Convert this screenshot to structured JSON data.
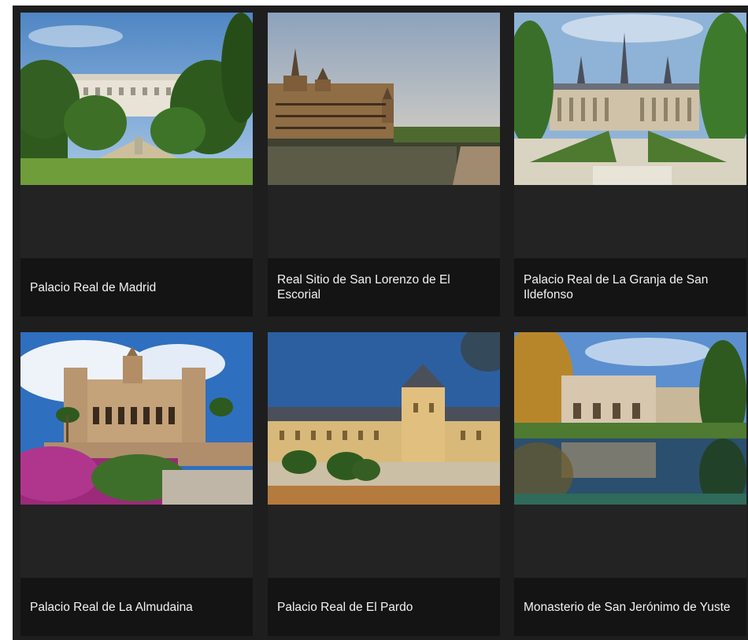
{
  "gallery": {
    "cards": [
      {
        "title": "Palacio Real de Madrid",
        "image": "palace-madrid-photo"
      },
      {
        "title": "Real Sitio de San Lorenzo de El Escorial",
        "image": "escorial-photo"
      },
      {
        "title": "Palacio Real de La Granja de San Ildefonso",
        "image": "la-granja-photo"
      },
      {
        "title": "Palacio Real de La Almudaina",
        "image": "almudaina-photo"
      },
      {
        "title": "Palacio Real de El Pardo",
        "image": "el-pardo-photo"
      },
      {
        "title": "Monasterio de San Jerónimo de Yuste",
        "image": "yuste-photo"
      }
    ]
  }
}
